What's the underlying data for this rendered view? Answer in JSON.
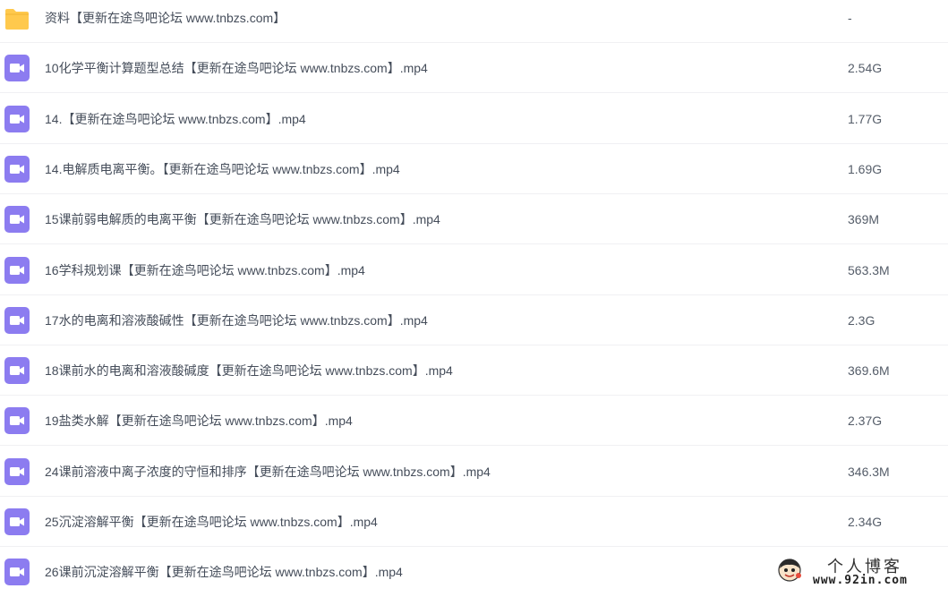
{
  "colors": {
    "folder_icon": "#FFC94D",
    "video_icon": "#8C7CF0",
    "row_divider": "#F0F0F3",
    "name_text": "#454D5A"
  },
  "files": [
    {
      "icon": "folder-icon",
      "name": "资料【更新在途鸟吧论坛 www.tnbzs.com】",
      "size": "-"
    },
    {
      "icon": "video-file-icon",
      "name": "10化学平衡计算题型总结【更新在途鸟吧论坛 www.tnbzs.com】.mp4",
      "size": "2.54G"
    },
    {
      "icon": "video-file-icon",
      "name": "14.【更新在途鸟吧论坛 www.tnbzs.com】.mp4",
      "size": "1.77G"
    },
    {
      "icon": "video-file-icon",
      "name": "14.电解质电离平衡。【更新在途鸟吧论坛 www.tnbzs.com】.mp4",
      "size": "1.69G"
    },
    {
      "icon": "video-file-icon",
      "name": "15课前弱电解质的电离平衡【更新在途鸟吧论坛 www.tnbzs.com】.mp4",
      "size": "369M"
    },
    {
      "icon": "video-file-icon",
      "name": "16学科规划课【更新在途鸟吧论坛 www.tnbzs.com】.mp4",
      "size": "563.3M"
    },
    {
      "icon": "video-file-icon",
      "name": "17水的电离和溶液酸碱性【更新在途鸟吧论坛 www.tnbzs.com】.mp4",
      "size": "2.3G"
    },
    {
      "icon": "video-file-icon",
      "name": "18课前水的电离和溶液酸碱度【更新在途鸟吧论坛 www.tnbzs.com】.mp4",
      "size": "369.6M"
    },
    {
      "icon": "video-file-icon",
      "name": "19盐类水解【更新在途鸟吧论坛 www.tnbzs.com】.mp4",
      "size": "2.37G"
    },
    {
      "icon": "video-file-icon",
      "name": "24课前溶液中离子浓度的守恒和排序【更新在途鸟吧论坛 www.tnbzs.com】.mp4",
      "size": "346.3M"
    },
    {
      "icon": "video-file-icon",
      "name": "25沉淀溶解平衡【更新在途鸟吧论坛 www.tnbzs.com】.mp4",
      "size": "2.34G"
    },
    {
      "icon": "video-file-icon",
      "name": "26课前沉淀溶解平衡【更新在途鸟吧论坛 www.tnbzs.com】.mp4",
      "size": ""
    }
  ],
  "watermark": {
    "title": "个人博客",
    "url": "www.92in.com"
  }
}
